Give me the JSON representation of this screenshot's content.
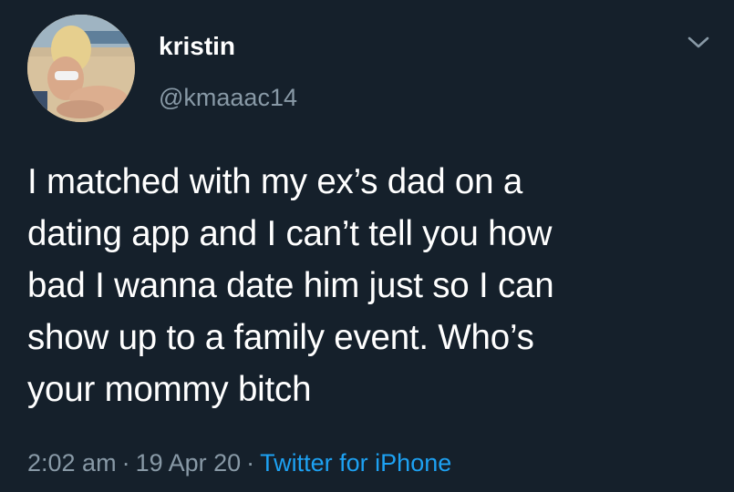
{
  "tweet": {
    "author": {
      "display_name": "kristin",
      "handle": "@kmaaac14",
      "avatar_icon": "profile-photo"
    },
    "menu_icon": "chevron-down-icon",
    "text_lines": [
      "I matched with my ex’s dad on a",
      "dating app and I can’t tell you how",
      "bad I wanna date him just so I can",
      "show up to a family event. Who’s",
      "your mommy bitch"
    ],
    "time": "2:02 am",
    "date": "19 Apr 20",
    "separator": "·",
    "source": "Twitter for iPhone"
  },
  "colors": {
    "background": "#15202b",
    "primary_text": "#ffffff",
    "secondary_text": "#8899a6",
    "link": "#1da1f2"
  }
}
